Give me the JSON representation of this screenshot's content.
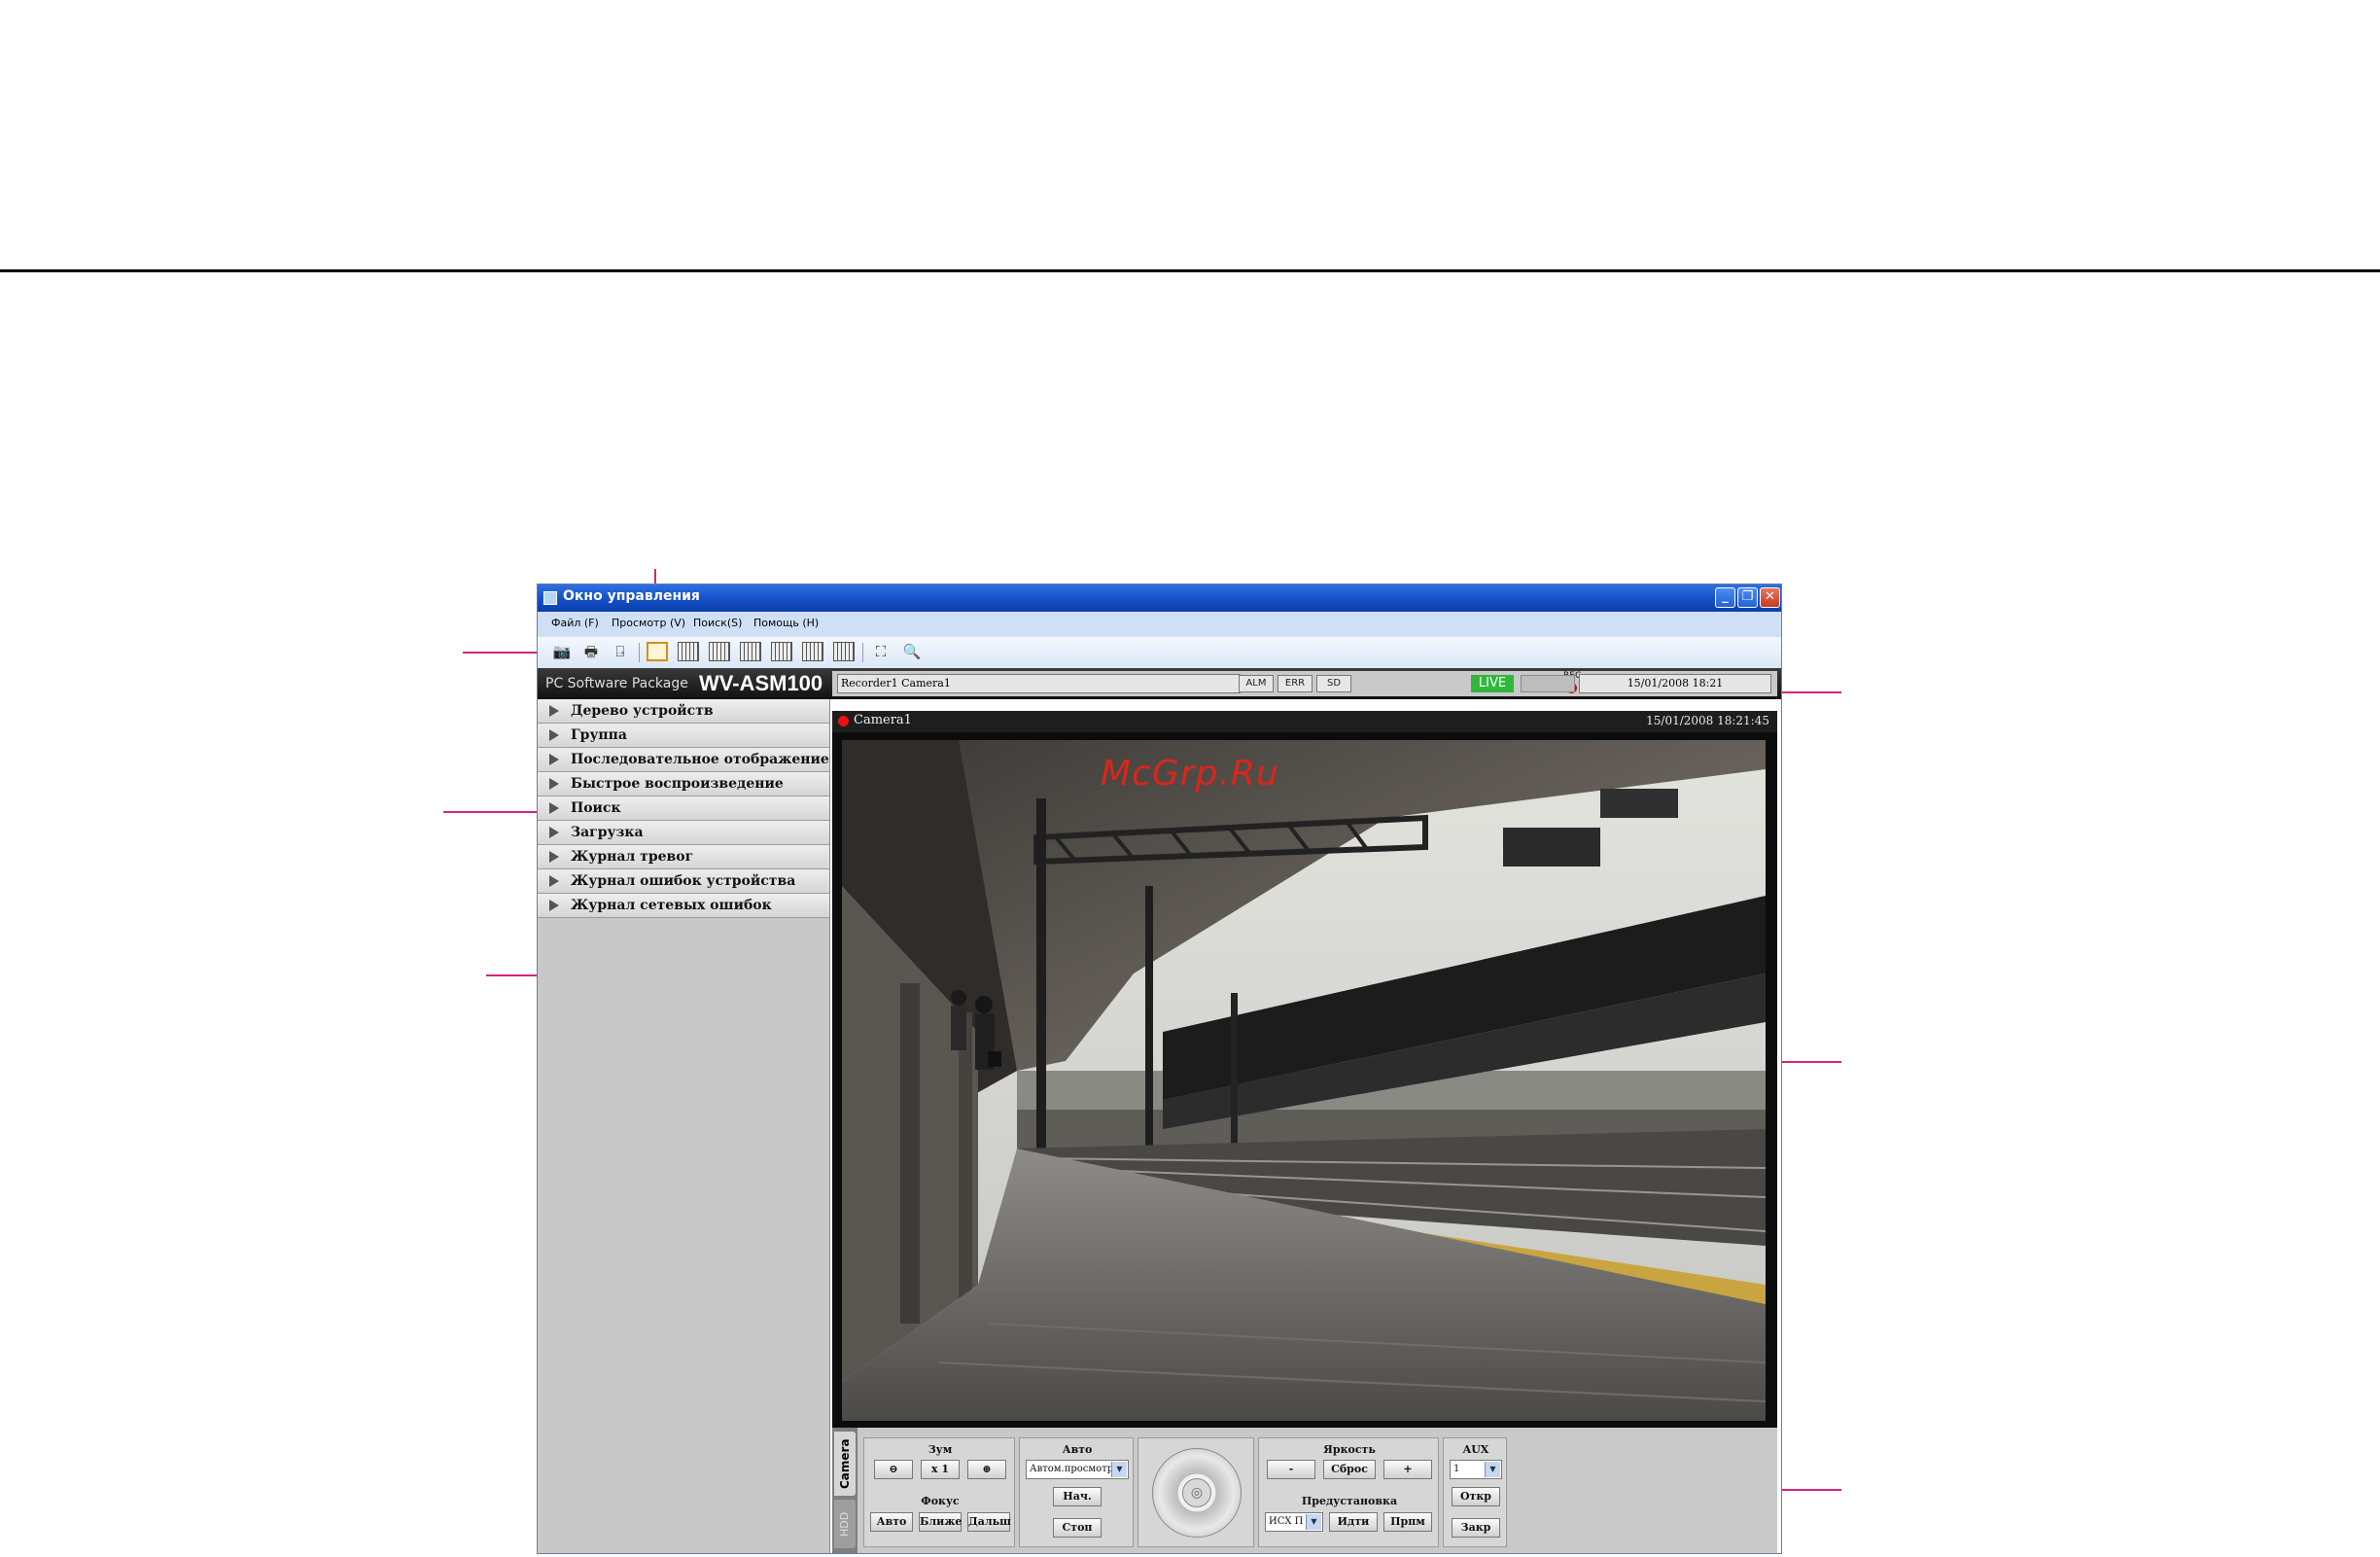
{
  "window": {
    "title": "Окно управления"
  },
  "menu": [
    "Файл (F)",
    "Просмотр (V)",
    "Поиск(S)",
    "Помощь (H)"
  ],
  "brand": {
    "small": "PC Software Package",
    "model": "WV-ASM100"
  },
  "status": {
    "title": "Recorder1 Camera1",
    "alm": "ALM",
    "err": "ERR",
    "sd": "SD",
    "live": "LIVE",
    "rec": "REC",
    "time": "15/01/2008 18:21"
  },
  "sidebar": {
    "items": [
      "Дерево устройств",
      "Группа",
      "Последовательное отображение",
      "Быстрое воспроизведение",
      "Поиск",
      "Загрузка",
      "Журнал тревог",
      "Журнал ошибок устройства",
      "Журнал сетевых ошибок"
    ]
  },
  "camera": {
    "name": "Camera1",
    "timestamp": "15/01/2008 18:21:45"
  },
  "ptz": {
    "tab_camera": "Camera",
    "tab_hdd": "HDD",
    "zoom_label": "Зум",
    "zoom_x1": "x 1",
    "focus_label": "Фокус",
    "focus_auto": "Авто",
    "focus_near": "Ближе",
    "focus_far": "Дальш",
    "auto_label": "Авто",
    "auto_select": "Автом.просмотр",
    "auto_start": "Нач.",
    "auto_stop": "Стоп",
    "brightness_label": "Яркость",
    "brightness_minus": "-",
    "brightness_reset": "Сброс",
    "brightness_plus": "+",
    "preset_label": "Предустановка",
    "preset_select": "ИСХ П",
    "preset_go": "Идти",
    "preset_set": "Прпм",
    "aux_label": "AUX",
    "aux_select": "1",
    "aux_open": "Откр",
    "aux_close": "Закр"
  },
  "watermark": "McGrp.Ru",
  "icons": {
    "snapshot": "camera-icon",
    "print": "printer-icon",
    "exit": "door-icon",
    "fullscreen": "expand-icon",
    "zoom_view": "magnifier-icon"
  },
  "colors": {
    "callout": "#d6247a",
    "live": "#2fb83a",
    "rec": "#e00000"
  }
}
